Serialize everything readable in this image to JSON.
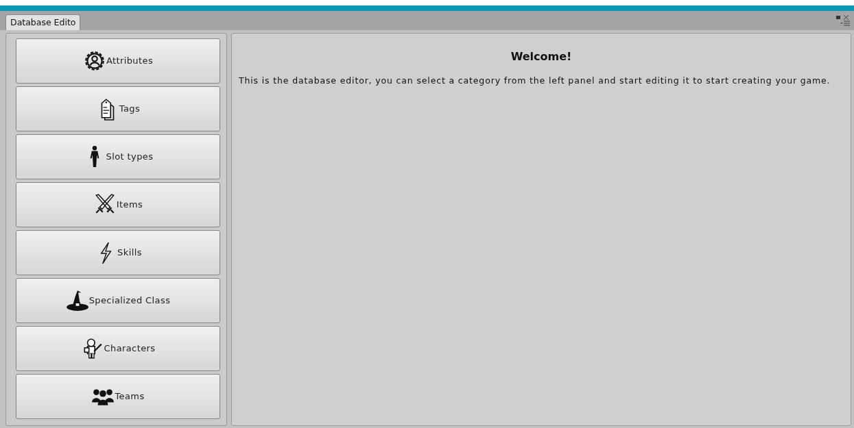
{
  "window": {
    "tab": "Database Edito"
  },
  "sidebar": {
    "items": [
      {
        "label": "Attributes"
      },
      {
        "label": "Tags"
      },
      {
        "label": "Slot types"
      },
      {
        "label": "Items"
      },
      {
        "label": "Skills"
      },
      {
        "label": "Specialized Class"
      },
      {
        "label": "Characters"
      },
      {
        "label": "Teams"
      }
    ]
  },
  "main": {
    "title": "Welcome!",
    "text": "This is the database editor, you can select a category from the left panel and start editing it to start creating your game."
  }
}
